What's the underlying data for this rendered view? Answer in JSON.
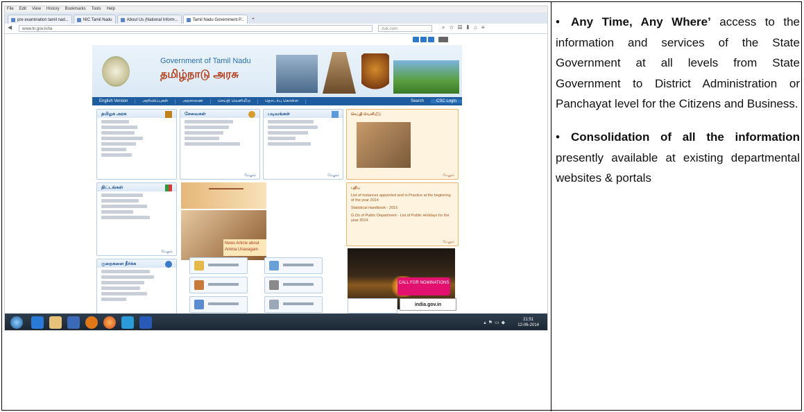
{
  "browser": {
    "menu": [
      "File",
      "Edit",
      "View",
      "History",
      "Bookmarks",
      "Tools",
      "Help"
    ],
    "tabs": [
      {
        "label": "pre examination tamil nad...",
        "active": false
      },
      {
        "label": "NIC Tamil Nadu",
        "active": false
      },
      {
        "label": "About Us (National Inform...",
        "active": false
      },
      {
        "label": "Tamil Nadu Government P...",
        "active": true
      }
    ],
    "url": "www.tn.gov.in/ta",
    "search_placeholder": "Ask.com"
  },
  "site": {
    "title_en": "Government of Tamil Nadu",
    "title_ta": "தமிழ்நாடு அரசு",
    "nav": [
      "English Version",
      "அறிவிப்புகள்",
      "அரசாணை",
      "செய்தி வெளியீடு",
      "தொடர்பு கொள்ள"
    ],
    "nav_search": "Search",
    "nav_csc": "CSC Login",
    "boxes": {
      "tn_govt": "தமிழக அரசு",
      "services": "சேவைகள்",
      "forms": "படிவங்கள்",
      "press": "செய்தி வெளியீடு",
      "schemes": "திட்டங்கள்",
      "grievance": "குறைகளை தீர்க்க",
      "new": "புதிய"
    },
    "more_label": "மேலும்",
    "new_items": [
      "List of instances appointed and in Practice at the beginning of the year 2014",
      "Statistical Handbook - 2015",
      "G.Os of Public Department - List of Public Holidays for the year 2014"
    ],
    "news_caption": "News Article about Amma Unavagam",
    "tiles": [
      "ஆவணங்கள்",
      "ஒப்பந்தப்புள்ளிகள்",
      "மக்கள் சாசனம்",
      "சட்டங்கள் மற்றும் விதிமுறைகள்",
      "தொடர்பு கொள்ள & தகவல் அறிய உரிமை தொடர்பான",
      "இணைய தளங்கள்",
      "தமிழ் களஞ்சியம்"
    ],
    "call_for": "CALL FOR NOMINATIONS",
    "india_portal": "india.gov.in"
  },
  "taskbar": {
    "time": "21:51",
    "date": "12-06-2014"
  },
  "description": {
    "point1_bold": "Any Time, Any Where’",
    "point1_rest": " access to the information and services of the State Government at all levels from State Government to District Administration or Panchayat level for the Citizens and Business.",
    "point2_bold": "Consolidation of all the information",
    "point2_rest": " presently available at existing departmental websites & portals"
  }
}
